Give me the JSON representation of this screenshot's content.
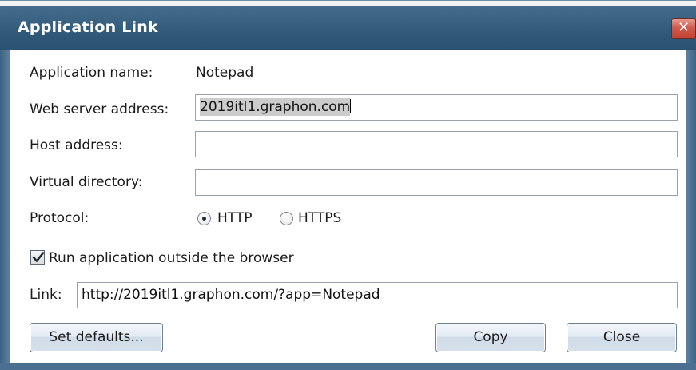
{
  "window": {
    "title": "Application Link",
    "close_glyph": "✕"
  },
  "form": {
    "app_name_label": "Application name:",
    "app_name_value": "Notepad",
    "web_server_label": "Web server address:",
    "web_server_value": "2019itl1.graphon.com",
    "host_address_label": "Host address:",
    "host_address_value": "",
    "virtual_dir_label": "Virtual directory:",
    "virtual_dir_value": "",
    "protocol_label": "Protocol:",
    "protocol_options": [
      "HTTP",
      "HTTPS"
    ],
    "protocol_selected": "HTTP",
    "run_outside_label": "Run application outside the browser",
    "run_outside_checked": true,
    "link_label": "Link:",
    "link_value": "http://2019itl1.graphon.com/?app=Notepad"
  },
  "buttons": {
    "set_defaults": "Set defaults...",
    "copy": "Copy",
    "close": "Close"
  },
  "colors": {
    "title_bar": "#2f5878",
    "close_button": "#c24133",
    "selection_highlight": "#cccccc"
  }
}
